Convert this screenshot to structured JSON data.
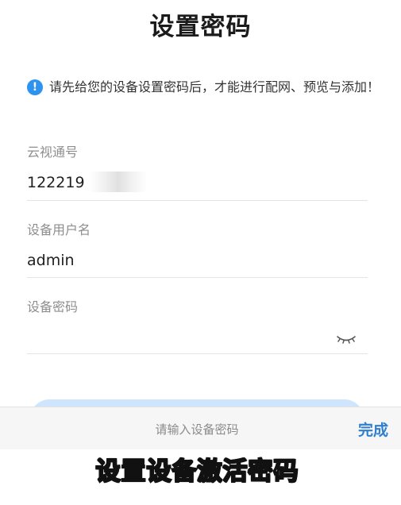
{
  "page": {
    "title": "设置密码"
  },
  "notice": {
    "icon": "info-exclamation-icon",
    "text": "请先给您的设备设置密码后，才能进行配网、预览与添加！",
    "icon_color": "#2e93ef"
  },
  "form": {
    "cloud_id": {
      "label": "云视通号",
      "value": "122219"
    },
    "username": {
      "label": "设备用户名",
      "value": "admin"
    },
    "password": {
      "label": "设备密码",
      "value": "",
      "visibility_icon": "eye-closed-icon"
    }
  },
  "keyboard_bar": {
    "placeholder": "请输入设备密码",
    "done_label": "完成",
    "done_color": "#2f7fd0"
  },
  "caption": {
    "text": "设置设备激活密码"
  },
  "colors": {
    "button_bg": "#cfe5fb"
  }
}
